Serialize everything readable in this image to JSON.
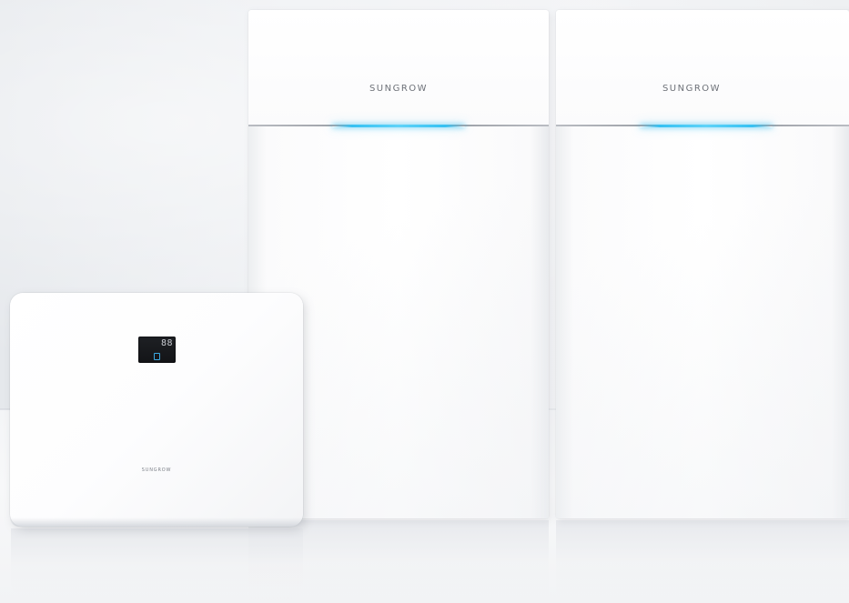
{
  "battery_modules": [
    {
      "brand_label": "SUNGROW"
    },
    {
      "brand_label": "SUNGROW"
    }
  ],
  "inverter": {
    "brand_label": "SUNGROW",
    "display_readout": "88"
  },
  "colors": {
    "led_accent": "#36c1f2",
    "wall": "#eceef1",
    "unit_white": "#ffffff",
    "display_bg": "#1a1c20"
  }
}
